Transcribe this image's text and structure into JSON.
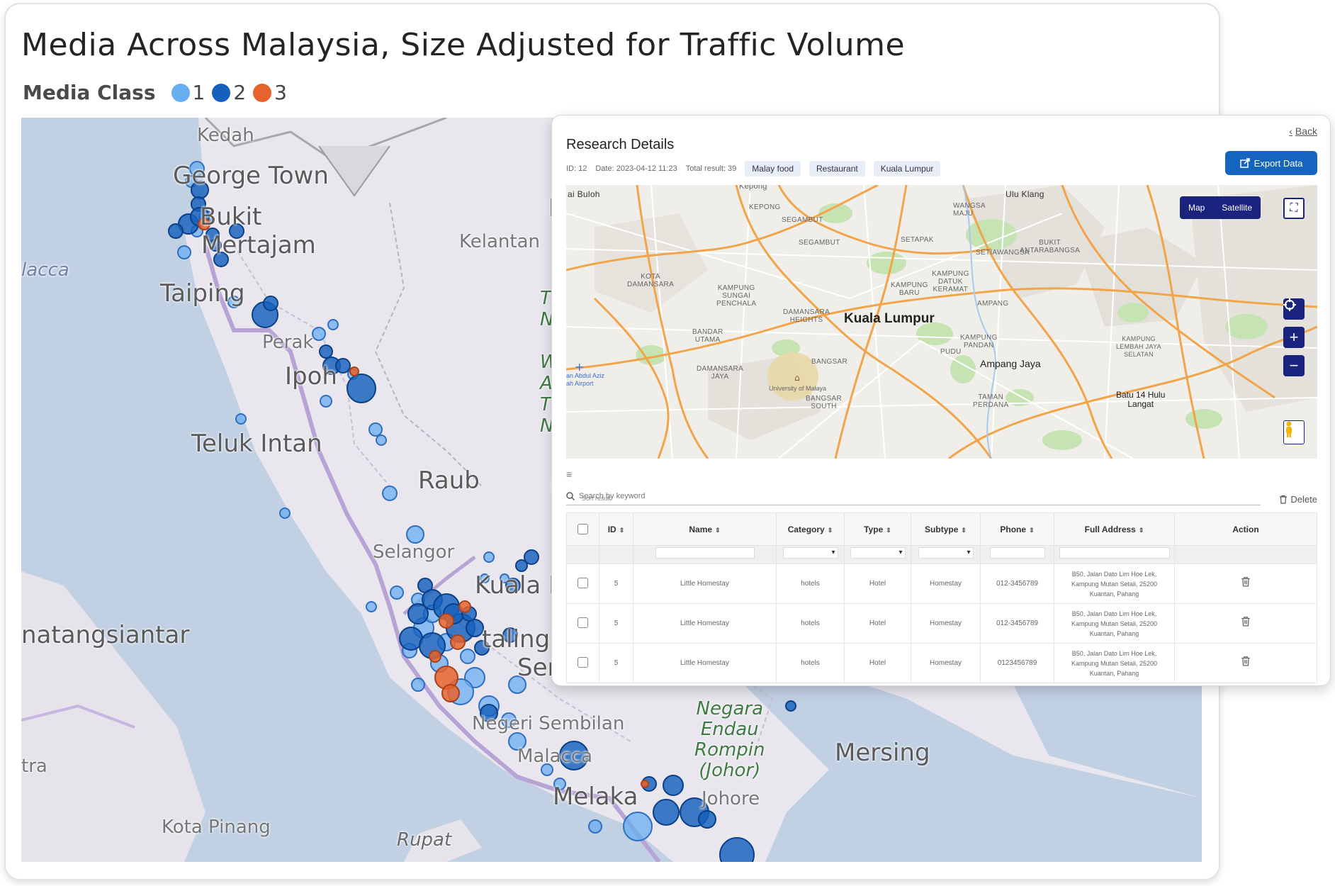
{
  "dashboard": {
    "title": "Media Across Malaysia, Size Adjusted for Traffic Volume",
    "legend": {
      "title": "Media Class",
      "items": [
        {
          "label": "1",
          "color": "#6aaef2"
        },
        {
          "label": "2",
          "color": "#1560bd"
        },
        {
          "label": "3",
          "color": "#e8632b"
        }
      ]
    },
    "map_labels": {
      "kedah": "Kedah",
      "george_town": "George Town",
      "bukit": "Bukit",
      "mertajam": "Mertajam",
      "malacca_sea": "lacca",
      "taiping": "Taiping",
      "perak": "Perak",
      "ipoh": "Ipoh",
      "kelantan": "Kelantan",
      "teluk_intan": "Teluk Intan",
      "raub": "Raub",
      "selangor": "Selangor",
      "kuala_lumpur": "Kuala Lu",
      "petaling": "taling",
      "seremban": "Seren",
      "pematangsiantar": "natangsiantar",
      "negeri_sembilan": "Negeri Sembilan",
      "malacca": "Malacca",
      "melaka": "Melaka",
      "johore": "Johore",
      "taman": "Taman",
      "negara_endau": "Negara\nEndau\nRompin\n(Johor)",
      "mersing": "Mersing",
      "tra": "tra",
      "kota_pinang": "Kota Pinang",
      "rupat": "Rupat",
      "k_edge": "K",
      "ne_edge": "T\nNe\n\nW\nA\nT\nN",
      "p_edge": "P"
    }
  },
  "research": {
    "back_label": "Back",
    "title": "Research Details",
    "meta": {
      "id": "ID: 12",
      "date": "Date: 2023-04-12 11:23",
      "total": "Total result: 39"
    },
    "tags": [
      "Malay food",
      "Restaurant",
      "Kuala Lumpur"
    ],
    "export_label": "Export Data",
    "map": {
      "toggle_map": "Map",
      "toggle_satellite": "Satellite",
      "labels": {
        "city": "Kuala Lumpur",
        "ampang_jaya": "Ampang Jaya",
        "batu14": "Batu 14 Hulu\nLangat",
        "sg_buloh": "ai Buloh",
        "ulu_klang": "Ulu Klang",
        "kepong": "KEPONG",
        "segambut": "SEGAMBUT",
        "setapak": "SETAPAK",
        "wangsa_maju": "WANGSA\nMAJU",
        "setiawangsa": "SETIAWANGSA",
        "bukit_antarabangsa": "BUKIT\nANTARABANGSA",
        "kota_damansara": "KOTA\nDAMANSARA",
        "kampung_sungai_penchala": "KAMPUNG\nSUNGAI\nPENCHALA",
        "kampung_baru": "KAMPUNG\nBARU",
        "kampung_datuk_keramat": "KAMPUNG\nDATUK\nKERAMAT",
        "ampang": "AMPANG",
        "damansara_heights": "DAMANSARA\nHEIGHTS",
        "bandar_utama": "BANDAR\nUTAMA",
        "kampung_pandan": "KAMPUNG\nPANDAN",
        "kampung_lembah_jaya": "KAMPUNG\nLEMBAH JAYA\nSELATAN",
        "pudu": "PUDU",
        "damansara_jaya": "DAMANSARA\nJAYA",
        "bangsar": "BANGSAR",
        "bangsar_south": "BANGSAR\nSOUTH",
        "university_malaya": "University of Malaya",
        "airport": "an Abdul Aziz\nah Airport",
        "taman_perdana": "TAMAN\nPERDANA",
        "kepong_top": "Kepong"
      }
    },
    "sort_label": "Sort result",
    "search_placeholder": "Search by keyword",
    "delete_label": "Delete",
    "columns": [
      "ID",
      "Name",
      "Category",
      "Type",
      "Subtype",
      "Phone",
      "Full Address",
      "Action"
    ],
    "rows": [
      {
        "id": "5",
        "name": "Little Homestay",
        "category": "hotels",
        "type": "Hotel",
        "subtype": "Homestay",
        "phone": "012-3456789",
        "address": "B50, Jalan Dato Lim Hoe Lek,\nKampung Mutan Setali, 25200\nKuantan, Pahang"
      },
      {
        "id": "5",
        "name": "Little Homestay",
        "category": "hotels",
        "type": "Hotel",
        "subtype": "Homestay",
        "phone": "012-3456789",
        "address": "B50, Jalan Dato Lim Hoe Lek,\nKampung Mutan Setali, 25200\nKuantan, Pahang"
      },
      {
        "id": "5",
        "name": "Little Homestay",
        "category": "hotels",
        "type": "Hotel",
        "subtype": "Homestay",
        "phone": "0123456789",
        "address": "B50, Jalan Dato Lim Hoe Lek,\nKampung Mutan Setali, 25200\nKuantan, Pahang"
      }
    ]
  }
}
